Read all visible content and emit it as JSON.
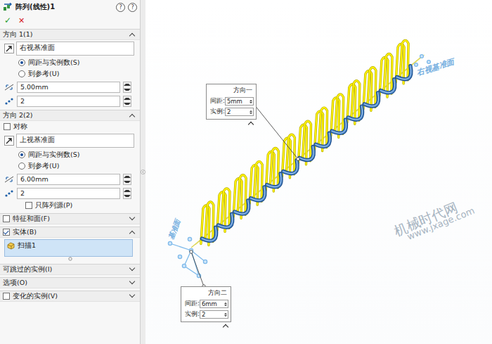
{
  "panel": {
    "title": "阵列(线性)1",
    "help": [
      "?",
      "?"
    ],
    "ok": "✓",
    "cancel": "✕",
    "direction1": {
      "header": "方向 1(1)",
      "expanded": true,
      "reference": "右视基准面",
      "modes": [
        {
          "label": "间距与实例数(S)",
          "selected": true
        },
        {
          "label": "到参考(U)",
          "selected": false
        }
      ],
      "spacing": "5.00mm",
      "count": "2"
    },
    "direction2": {
      "header": "方向 2(2)",
      "expanded": true,
      "symmetric": {
        "label": "对称",
        "checked": false
      },
      "reference": "上视基准面",
      "modes": [
        {
          "label": "间距与实例数(S)",
          "selected": true
        },
        {
          "label": "到参考(U)",
          "selected": false
        }
      ],
      "spacing": "6.00mm",
      "count": "2",
      "seed_only": {
        "label": "只阵列源(P)",
        "checked": false
      }
    },
    "features": {
      "header": "特征和面(F)",
      "checked": false,
      "expanded": false
    },
    "bodies": {
      "header": "实体(B)",
      "checked": true,
      "expanded": true,
      "items": [
        "扫描1"
      ]
    },
    "skipped": {
      "header": "可跳过的实例(I)",
      "expanded": false
    },
    "options": {
      "header": "选项(O)",
      "expanded": false
    },
    "varied": {
      "header": "变化的实例(V)",
      "checked": false,
      "expanded": false
    }
  },
  "viewport": {
    "callouts": [
      {
        "title": "方向一",
        "rows": [
          {
            "label": "间距:",
            "value": "5mm"
          },
          {
            "label": "实例:",
            "value": "2"
          }
        ]
      },
      {
        "title": "方向二",
        "rows": [
          {
            "label": "间距:",
            "value": "6mm"
          },
          {
            "label": "实例:",
            "value": "2"
          }
        ]
      }
    ],
    "plane_labels": [
      "右视基准面",
      "基准面"
    ],
    "watermark": [
      "机械时代网",
      "www.jxage.com"
    ]
  }
}
